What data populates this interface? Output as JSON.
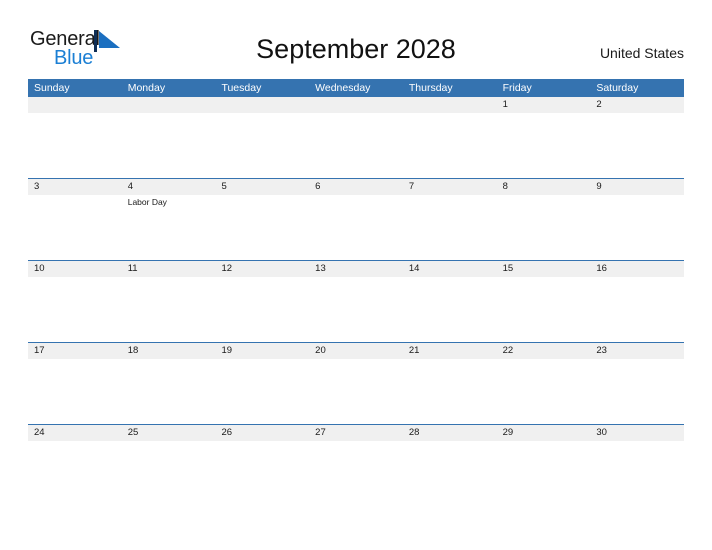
{
  "brand": {
    "word_one": "General",
    "word_two": "Blue",
    "logo_color": "#1b7fd4",
    "text_color": "#1a1a1a"
  },
  "header": {
    "title": "September 2028",
    "locale": "United States"
  },
  "colors": {
    "header_band": "#3573b0",
    "number_band": "#f0f0f0",
    "row_border": "#3573b0",
    "page_background": "#ffffff"
  },
  "calendar": {
    "weekdays": [
      "Sunday",
      "Monday",
      "Tuesday",
      "Wednesday",
      "Thursday",
      "Friday",
      "Saturday"
    ],
    "weeks": [
      {
        "days": [
          {
            "number": "",
            "events": []
          },
          {
            "number": "",
            "events": []
          },
          {
            "number": "",
            "events": []
          },
          {
            "number": "",
            "events": []
          },
          {
            "number": "",
            "events": []
          },
          {
            "number": "1",
            "events": []
          },
          {
            "number": "2",
            "events": []
          }
        ]
      },
      {
        "days": [
          {
            "number": "3",
            "events": []
          },
          {
            "number": "4",
            "events": [
              "Labor Day"
            ]
          },
          {
            "number": "5",
            "events": []
          },
          {
            "number": "6",
            "events": []
          },
          {
            "number": "7",
            "events": []
          },
          {
            "number": "8",
            "events": []
          },
          {
            "number": "9",
            "events": []
          }
        ]
      },
      {
        "days": [
          {
            "number": "10",
            "events": []
          },
          {
            "number": "11",
            "events": []
          },
          {
            "number": "12",
            "events": []
          },
          {
            "number": "13",
            "events": []
          },
          {
            "number": "14",
            "events": []
          },
          {
            "number": "15",
            "events": []
          },
          {
            "number": "16",
            "events": []
          }
        ]
      },
      {
        "days": [
          {
            "number": "17",
            "events": []
          },
          {
            "number": "18",
            "events": []
          },
          {
            "number": "19",
            "events": []
          },
          {
            "number": "20",
            "events": []
          },
          {
            "number": "21",
            "events": []
          },
          {
            "number": "22",
            "events": []
          },
          {
            "number": "23",
            "events": []
          }
        ]
      },
      {
        "days": [
          {
            "number": "24",
            "events": []
          },
          {
            "number": "25",
            "events": []
          },
          {
            "number": "26",
            "events": []
          },
          {
            "number": "27",
            "events": []
          },
          {
            "number": "28",
            "events": []
          },
          {
            "number": "29",
            "events": []
          },
          {
            "number": "30",
            "events": []
          }
        ]
      }
    ]
  }
}
